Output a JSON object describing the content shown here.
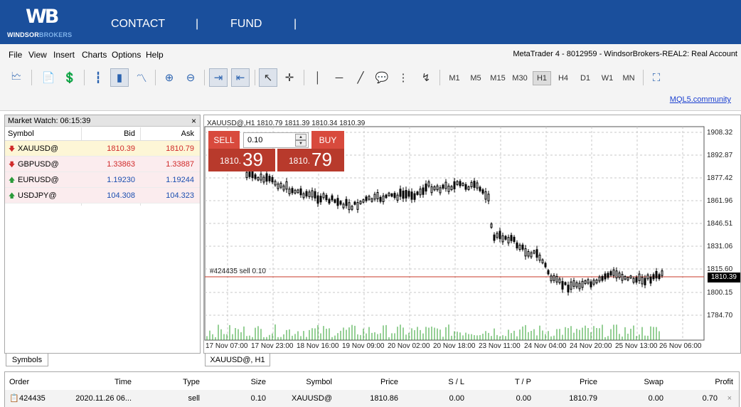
{
  "brand": {
    "logo_mark": "WB",
    "logo_word_a": "WINDSOR",
    "logo_word_b": "BROKERS"
  },
  "topnav": {
    "contact": "CONTACT",
    "sep": "|",
    "fund": "FUND"
  },
  "menu": {
    "file": "File",
    "view": "View",
    "insert": "Insert",
    "charts": "Charts",
    "options": "Options",
    "help": "Help",
    "account": "MetaTrader 4 - 8012959 - WindsorBrokers-REAL2: Real Account"
  },
  "toolbar": {
    "timeframes": [
      "M1",
      "M5",
      "M15",
      "M30",
      "H1",
      "H4",
      "D1",
      "W1",
      "MN"
    ],
    "active_timeframe": "H1",
    "mql_link": "MQL5.community"
  },
  "market_watch": {
    "title": "Market Watch: 06:15:39",
    "close": "×",
    "col_symbol": "Symbol",
    "col_bid": "Bid",
    "col_ask": "Ask",
    "rows": [
      {
        "symbol": "XAUUSD@",
        "bid": "1810.39",
        "ask": "1810.79",
        "dir": "down"
      },
      {
        "symbol": "GBPUSD@",
        "bid": "1.33863",
        "ask": "1.33887",
        "dir": "down"
      },
      {
        "symbol": "EURUSD@",
        "bid": "1.19230",
        "ask": "1.19244",
        "dir": "up"
      },
      {
        "symbol": "USDJPY@",
        "bid": "104.308",
        "ask": "104.323",
        "dir": "up"
      }
    ],
    "tab": "Symbols"
  },
  "chart": {
    "header": "XAUUSD@,H1  1810.79 1811.39 1810.34 1810.39",
    "tab": "XAUUSD@, H1",
    "order_label": "#424435 sell 0.10",
    "current_price": "1810.39",
    "price_labels": [
      "1908.32",
      "1892.87",
      "1877.42",
      "1861.96",
      "1846.51",
      "1831.06",
      "1815.60",
      "1800.15",
      "1784.70"
    ],
    "time_labels": [
      "17 Nov 07:00",
      "17 Nov 23:00",
      "18 Nov 16:00",
      "19 Nov 09:00",
      "20 Nov 02:00",
      "20 Nov 18:00",
      "23 Nov 11:00",
      "24 Nov 04:00",
      "24 Nov 20:00",
      "25 Nov 13:00",
      "26 Nov 06:00"
    ]
  },
  "one_click": {
    "sell_label": "SELL",
    "buy_label": "BUY",
    "volume": "0.10",
    "sell_small": "1810.",
    "sell_big": "39",
    "buy_small": "1810.",
    "buy_big": "79"
  },
  "trade": {
    "headers": {
      "order": "Order",
      "time": "Time",
      "type": "Type",
      "size": "Size",
      "symbol": "Symbol",
      "price": "Price",
      "sl": "S / L",
      "tp": "T / P",
      "price2": "Price",
      "swap": "Swap",
      "profit": "Profit"
    },
    "row": {
      "order": "424435",
      "time": "2020.11.26 06...",
      "type": "sell",
      "size": "0.10",
      "symbol": "XAUUSD@",
      "price": "1810.86",
      "sl": "0.00",
      "tp": "0.00",
      "price2": "1810.79",
      "swap": "0.00",
      "profit": "0.70",
      "close": "×"
    }
  },
  "colors": {
    "brand_blue": "#1a4f9c",
    "sell_red": "#d84a3d",
    "quote_red": "#b83a2c",
    "down_text": "#d02a2a",
    "up_text": "#1c4fb0"
  }
}
